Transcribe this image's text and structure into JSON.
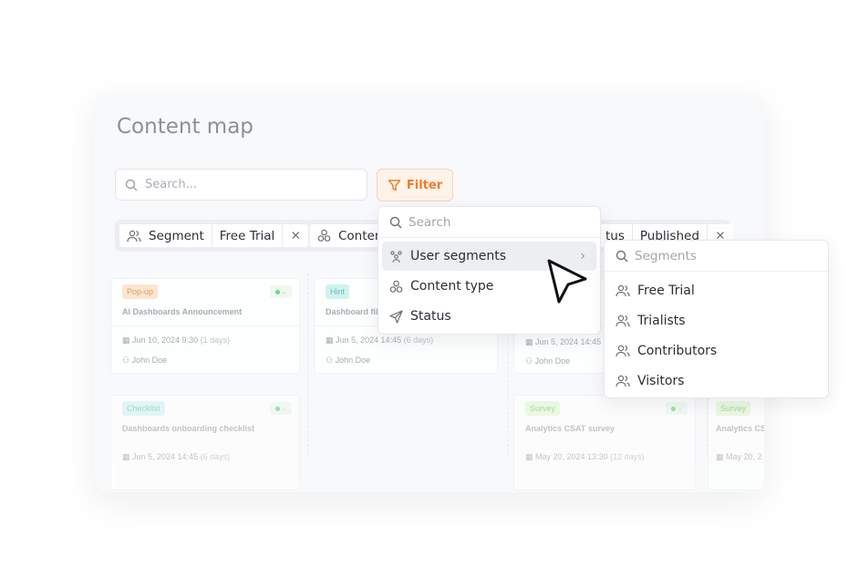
{
  "page": {
    "title": "Content map"
  },
  "search": {
    "placeholder": "Search..."
  },
  "filter_button": {
    "label": "Filter",
    "color": "#f07b2c"
  },
  "chips": [
    {
      "field": "Segment",
      "value": "Free Trial",
      "icon": "users-icon"
    },
    {
      "field": "Conten",
      "icon": "content-type-icon"
    },
    {
      "field": "tus",
      "value": "Published"
    }
  ],
  "cards": [
    {
      "badge": "Pop-up",
      "badge_color": "#fde3c8",
      "title": "AI Dashboards Announcement",
      "date": "Jun 10, 2024 9:30",
      "ago": "(1 days)",
      "author": "John Doe"
    },
    {
      "badge": "Hint",
      "badge_color": "#c8f3ee",
      "title": "Dashboard filt",
      "date": "Jun 5, 2024 14:45",
      "ago": "(6 days)",
      "author": "John Doe"
    },
    {
      "date": "Jun 5, 2024 14:45",
      "author": "John Doe"
    },
    {
      "badge": "Checklist",
      "badge_color": "#d2f5f0",
      "title": "Dashboards onboarding checklist",
      "date": "Jun 5, 2024 14:45",
      "ago": "(6 days)"
    },
    {
      "badge": "Survey",
      "badge_color": "#e2f8d4",
      "title": "Analytics CSAT survey",
      "date": "May 20, 2024 13:30",
      "ago": "(12 days)"
    },
    {
      "badge": "Survey",
      "badge_color": "#e2f8d4",
      "title": "Analytics CS",
      "date": "May 20, 2"
    }
  ],
  "filter_menu": {
    "search_placeholder": "Search",
    "items": [
      {
        "label": "User segments",
        "icon": "user-segments-icon",
        "active": true
      },
      {
        "label": "Content type",
        "icon": "content-type-icon"
      },
      {
        "label": "Status",
        "icon": "send-icon"
      }
    ]
  },
  "segments_menu": {
    "search_placeholder": "Segments",
    "items": [
      {
        "label": "Free Trial"
      },
      {
        "label": "Trialists"
      },
      {
        "label": "Contributors"
      },
      {
        "label": "Visitors"
      }
    ]
  }
}
